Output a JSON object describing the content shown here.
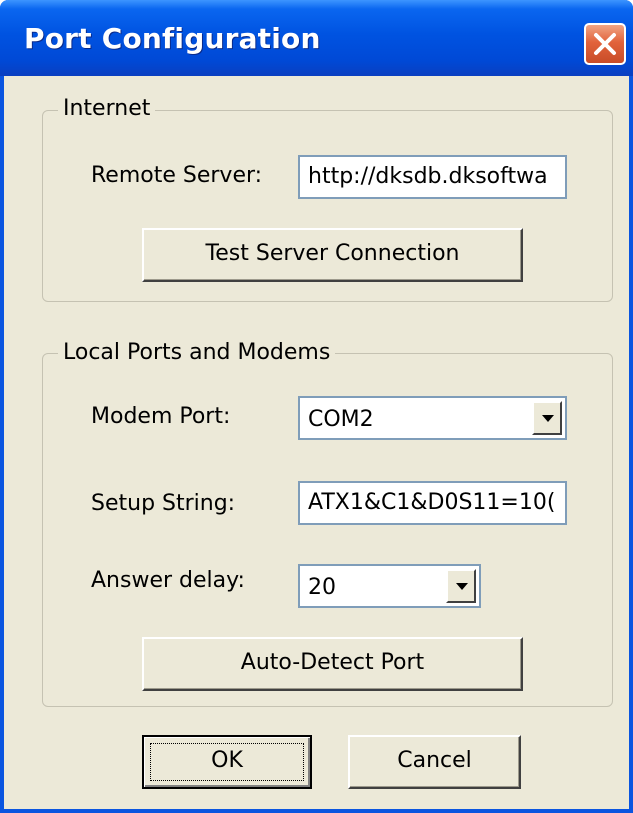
{
  "window": {
    "title": "Port Configuration"
  },
  "internet": {
    "legend": "Internet",
    "remote_server_label": "Remote Server:",
    "remote_server_value": "http://dksdb.dksoftwa",
    "test_button": "Test Server Connection"
  },
  "local": {
    "legend": "Local Ports and Modems",
    "modem_port_label": "Modem Port:",
    "modem_port_value": "COM2",
    "setup_string_label": "Setup String:",
    "setup_string_value": "ATX1&C1&D0S11=10(",
    "answer_delay_label": "Answer delay:",
    "answer_delay_value": "20",
    "autodetect_button": "Auto-Detect Port"
  },
  "footer": {
    "ok_label": "OK",
    "cancel_label": "Cancel"
  },
  "icons": {
    "close": "close-icon",
    "dropdown": "chevron-down-icon"
  },
  "colors": {
    "titlebar": "#0053e1",
    "close_button": "#e2633b",
    "dialog_background": "#ece9d8",
    "textbox_border": "#7f9db9"
  }
}
